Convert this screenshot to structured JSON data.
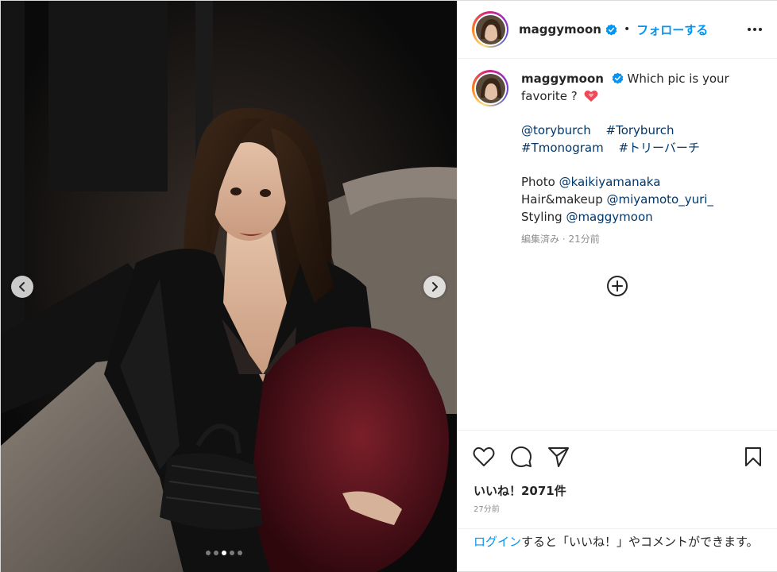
{
  "post": {
    "username": "maggymoon",
    "verified": true,
    "separator": "•",
    "follow_label": "フォローする",
    "more_icon": "more-horizontal-icon"
  },
  "media": {
    "slide_count": 5,
    "active_slide": 3,
    "prev_icon": "chevron-left-icon",
    "next_icon": "chevron-right-icon"
  },
  "caption": {
    "username": "maggymoon",
    "text_line1": "Which pic is your favorite ?",
    "emoji": "heart",
    "tags": [
      "@toryburch",
      "#Toryburch",
      "#Tmonogram",
      "#トリーバーチ"
    ],
    "credits": [
      {
        "label": "Photo",
        "handle": "@kaikiyamanaka"
      },
      {
        "label": "Hair&makeup",
        "handle": "@miyamoto_yuri_"
      },
      {
        "label": "Styling",
        "handle": "@maggymoon"
      }
    ],
    "meta": "編集済み · 21分前"
  },
  "actions": {
    "like_icon": "heart-icon",
    "comment_icon": "comment-icon",
    "share_icon": "send-icon",
    "save_icon": "bookmark-icon",
    "add_icon": "add-circle-icon",
    "likes": "いいね！2071件",
    "time_ago": "27分前"
  },
  "login_prompt": {
    "link": "ログイン",
    "rest": "すると「いいね！」やコメントができます。"
  },
  "colors": {
    "accent": "#0095f6",
    "link": "#00376b",
    "muted": "#8e8e8e",
    "heart": "#ed4956"
  }
}
